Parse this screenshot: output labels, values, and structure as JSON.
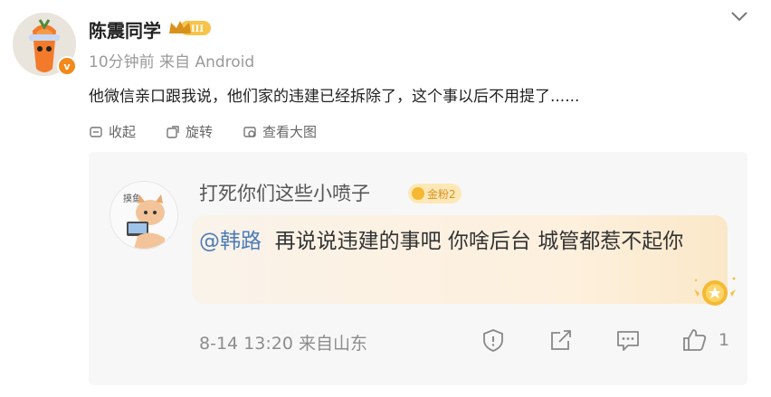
{
  "post": {
    "author": "陈震同学",
    "level_badge": "III",
    "verified_mark": "v",
    "time_label": "10分钟前",
    "source_label": "来自 Android",
    "text": "他微信亲口跟我说，他们家的违建已经拆除了，这个事以后不用提了......"
  },
  "actions": {
    "collapse": "收起",
    "rotate": "旋转",
    "view_large": "查看大图"
  },
  "comment": {
    "author": "打死你们这些小喷子",
    "fan_badge": "金粉2",
    "mention": "@韩路",
    "text": "再说说违建的事吧 你啥后台 城管都惹不起你",
    "time": "8-14 13:20",
    "location": "来自山东",
    "like_count": "1",
    "avatar_text": "摸鱼"
  },
  "colors": {
    "mention": "#4c7cba",
    "badge_orange": "#f28a1c",
    "fan_badge_bg": "#ffe8b8",
    "card_bg": "#f7f7f7"
  },
  "icons": [
    "chevron-down-icon",
    "collapse-icon",
    "rotate-icon",
    "view-image-icon",
    "report-icon",
    "share-icon",
    "comment-icon",
    "like-icon",
    "gold-medal-icon",
    "crown-icon"
  ]
}
